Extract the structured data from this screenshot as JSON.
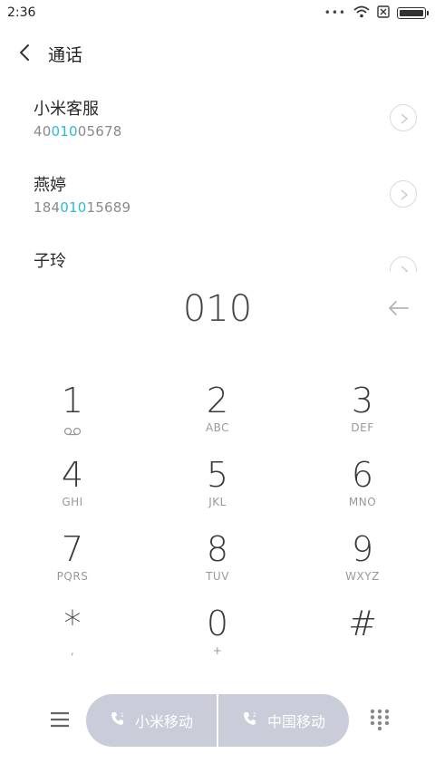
{
  "status_bar": {
    "time": "2:36",
    "dots": "•••"
  },
  "header": {
    "title": "通话"
  },
  "contacts": [
    {
      "name": "小米客服",
      "number_pre": "40",
      "number_match": "010",
      "number_post": "05678"
    },
    {
      "name": "燕婷",
      "number_pre": "184",
      "number_match": "010",
      "number_post": "15689"
    },
    {
      "name": "子玲"
    }
  ],
  "dialer": {
    "number": "010"
  },
  "keypad": [
    {
      "digit": "1",
      "letters": ""
    },
    {
      "digit": "2",
      "letters": "ABC"
    },
    {
      "digit": "3",
      "letters": "DEF"
    },
    {
      "digit": "4",
      "letters": "GHI"
    },
    {
      "digit": "5",
      "letters": "JKL"
    },
    {
      "digit": "6",
      "letters": "MNO"
    },
    {
      "digit": "7",
      "letters": "PQRS"
    },
    {
      "digit": "8",
      "letters": "TUV"
    },
    {
      "digit": "9",
      "letters": "WXYZ"
    },
    {
      "digit": "*",
      "letters": ","
    },
    {
      "digit": "0",
      "letters": "+"
    },
    {
      "digit": "#",
      "letters": ""
    }
  ],
  "call_buttons": {
    "sim1": "小米移动",
    "sim2": "中国移动"
  },
  "colors": {
    "highlight": "#2bbbd8",
    "call_pill": "#c8cdd9"
  }
}
